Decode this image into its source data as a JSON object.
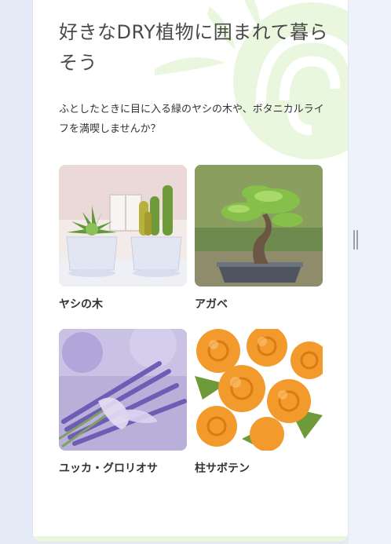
{
  "hero": {
    "title": "好きなDRY植物に囲まれて暮らそう",
    "description": "ふとしたときに目に入る緑のヤシの木や、ボタニカルライフを満喫しませんか？"
  },
  "plants": [
    {
      "label": "ヤシの木",
      "image": "succulents-in-white-pots-photo"
    },
    {
      "label": "アガベ",
      "image": "bonsai-tree-photo"
    },
    {
      "label": "ユッカ・グロリオサ",
      "image": "lavender-bouquet-photo"
    },
    {
      "label": "柱サボテン",
      "image": "orange-roses-photo"
    }
  ],
  "colors": {
    "page_bg": "#e4ebf6",
    "card_bg": "#ffffff",
    "sun_deco": "#eaf7df",
    "title_text": "#4a4a4a"
  }
}
